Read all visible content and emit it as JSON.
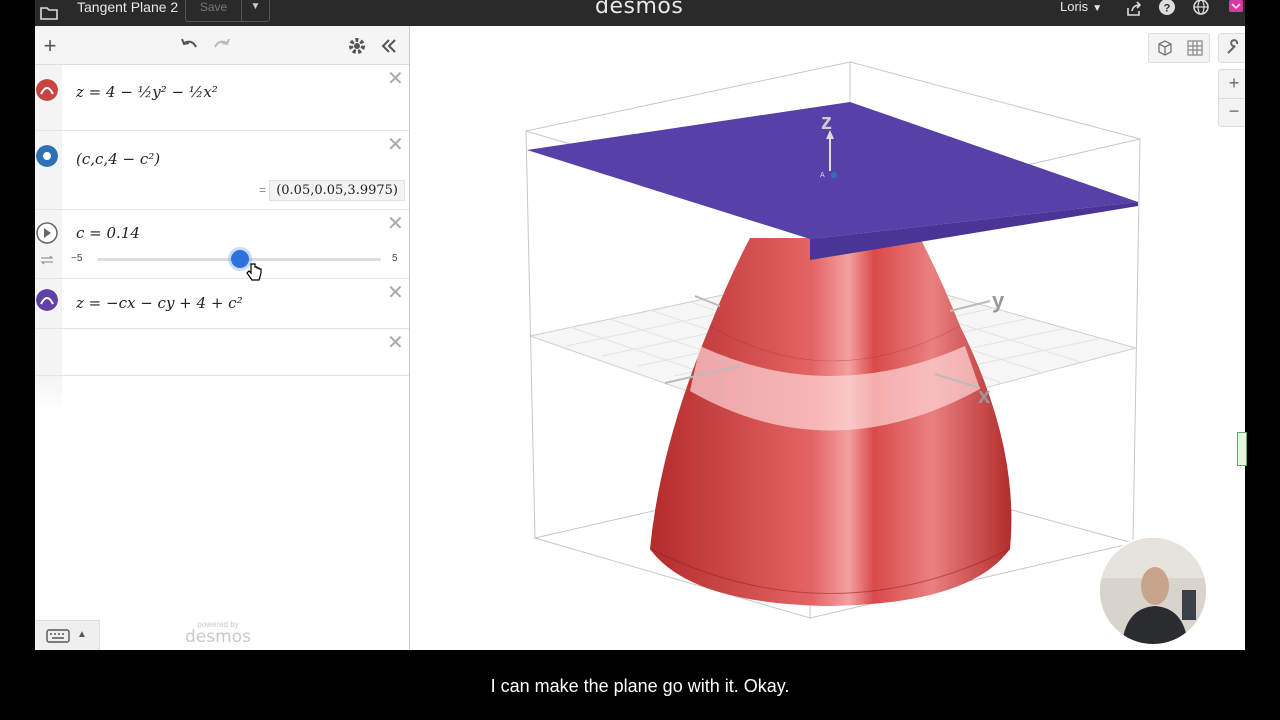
{
  "topbar": {
    "title": "Tangent Plane 2",
    "save_label": "Save",
    "logo": "desmos",
    "user": "Loris"
  },
  "expressions": [
    {
      "latex_text": "z = 4 − ½y² − ½x²",
      "color": "#c74440"
    },
    {
      "latex_text": "(c,c,4 − c²)",
      "color": "#2d70b3",
      "evaluation": "(0.05,0.05,3.9975)",
      "eq": "="
    },
    {
      "latex_text": "c = 0.14",
      "slider": {
        "min": "−5",
        "max": "5",
        "value": 0.14
      }
    },
    {
      "latex_text": "z = −cx − cy + 4 + c²",
      "color": "#6042a6"
    }
  ],
  "powered": {
    "line1": "powered by",
    "line2": "desmos"
  },
  "graph": {
    "axis_labels": {
      "x": "x",
      "y": "y",
      "z": "z"
    },
    "point_label": "A"
  },
  "caption": "I can make the plane go with it. Okay."
}
